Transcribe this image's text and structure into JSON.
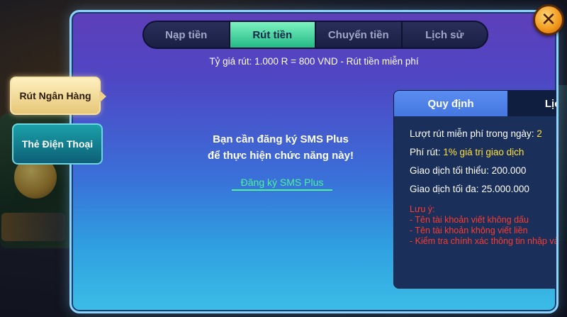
{
  "tabs": [
    {
      "label": "Nạp tiền",
      "active": false
    },
    {
      "label": "Rút tiền",
      "active": true
    },
    {
      "label": "Chuyển tiền",
      "active": false
    },
    {
      "label": "Lịch sử",
      "active": false
    }
  ],
  "rate_text": "Tỷ giá rút: 1.000 R = 800 VND  - Rút tiền miễn phí",
  "side_menu": [
    {
      "label": "Rút Ngân Hàng",
      "active": true
    },
    {
      "label": "Thẻ Điện Thoại",
      "active": false
    }
  ],
  "message": {
    "line1": "Bạn cần đăng ký SMS Plus",
    "line2": "để thực hiện chức năng này!",
    "link": "Đăng ký SMS Plus"
  },
  "panel": {
    "tabs": [
      {
        "label": "Quy định",
        "active": true
      },
      {
        "label": "Lịch sử",
        "active": false
      }
    ],
    "free_label": "Lượt rút miễn phí trong ngày:",
    "free_value": "2",
    "fee_label": "Phí rút:",
    "fee_value": "1% giá trị giao dịch",
    "min_label": "Giao dịch tối thiểu:",
    "min_value": "200.000",
    "max_label": "Giao dịch tối đa:",
    "max_value": "25.000.000",
    "note_title": "Lưu ý:",
    "notes": [
      "- Tên tài khoản viết không dấu",
      "- Tên tài khoản không viết liền",
      "- Kiểm tra chính xác thông tin nhập vào"
    ]
  },
  "close_symbol": "✕",
  "colors": {
    "accent_green": "#23b987",
    "warning_red": "#ff3b2f",
    "highlight_yellow": "#ffe23a",
    "link_green": "#4cf39a"
  }
}
